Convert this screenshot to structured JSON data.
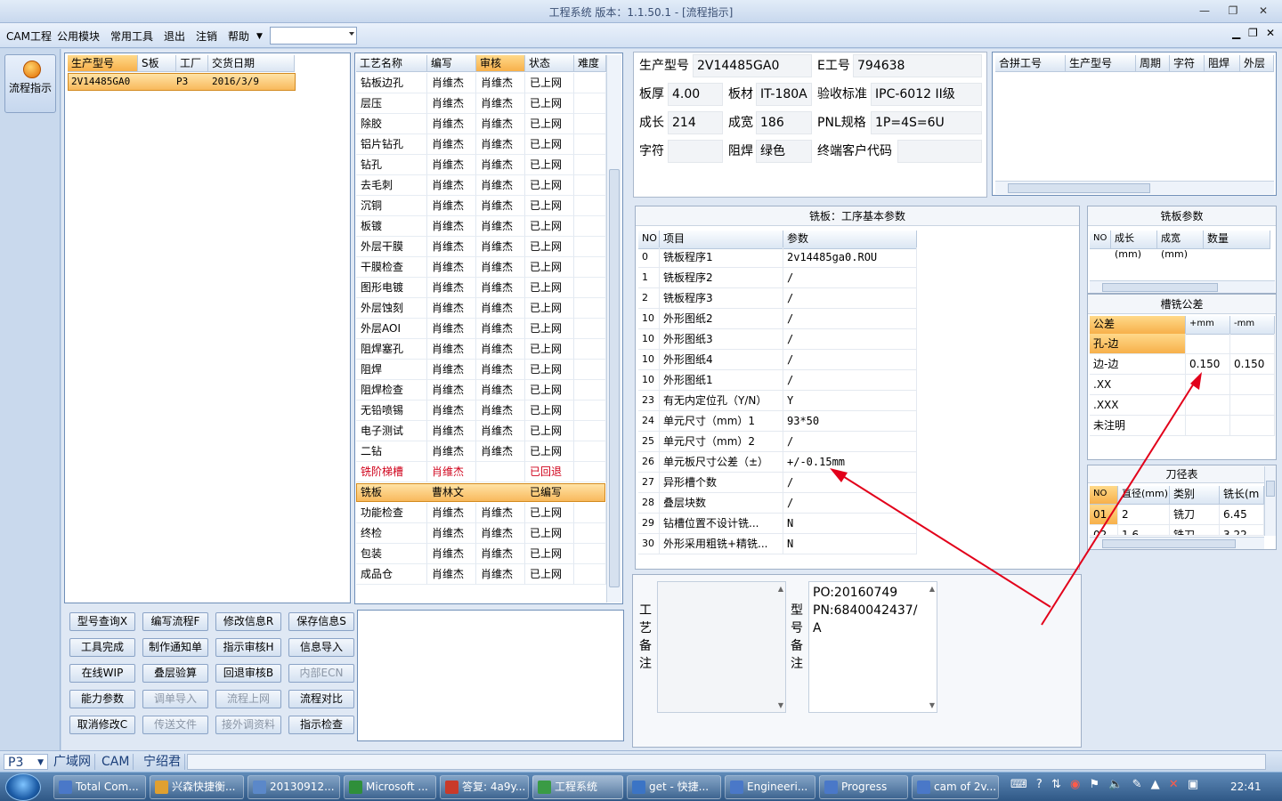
{
  "window": {
    "title": "工程系统   版本：1.1.50.1 - [流程指示]"
  },
  "menu": [
    "CAM工程",
    "公用模块",
    "常用工具",
    "退出",
    "注销",
    "帮助"
  ],
  "sidebar": {
    "label": "流程指示"
  },
  "orders": {
    "headers": [
      "生产型号",
      "S板",
      "工厂",
      "交货日期"
    ],
    "rows": [
      [
        "2V14485GA0",
        "",
        "P3",
        "2016/3/9"
      ]
    ]
  },
  "process": {
    "headers": [
      "工艺名称",
      "编写",
      "审核",
      "状态",
      "难度"
    ],
    "rows": [
      [
        "钻板边孔",
        "肖维杰",
        "肖维杰",
        "已上网"
      ],
      [
        "层压",
        "肖维杰",
        "肖维杰",
        "已上网"
      ],
      [
        "除胶",
        "肖维杰",
        "肖维杰",
        "已上网"
      ],
      [
        "铝片钻孔",
        "肖维杰",
        "肖维杰",
        "已上网"
      ],
      [
        "钻孔",
        "肖维杰",
        "肖维杰",
        "已上网"
      ],
      [
        "去毛刺",
        "肖维杰",
        "肖维杰",
        "已上网"
      ],
      [
        "沉铜",
        "肖维杰",
        "肖维杰",
        "已上网"
      ],
      [
        "板镀",
        "肖维杰",
        "肖维杰",
        "已上网"
      ],
      [
        "外层干膜",
        "肖维杰",
        "肖维杰",
        "已上网"
      ],
      [
        "干膜检查",
        "肖维杰",
        "肖维杰",
        "已上网"
      ],
      [
        "图形电镀",
        "肖维杰",
        "肖维杰",
        "已上网"
      ],
      [
        "外层蚀刻",
        "肖维杰",
        "肖维杰",
        "已上网"
      ],
      [
        "外层AOI",
        "肖维杰",
        "肖维杰",
        "已上网"
      ],
      [
        "阻焊塞孔",
        "肖维杰",
        "肖维杰",
        "已上网"
      ],
      [
        "阻焊",
        "肖维杰",
        "肖维杰",
        "已上网"
      ],
      [
        "阻焊检查",
        "肖维杰",
        "肖维杰",
        "已上网"
      ],
      [
        "无铅喷锡",
        "肖维杰",
        "肖维杰",
        "已上网"
      ],
      [
        "电子测试",
        "肖维杰",
        "肖维杰",
        "已上网"
      ],
      [
        "二钻",
        "肖维杰",
        "肖维杰",
        "已上网"
      ],
      [
        "铣阶梯槽",
        "肖维杰",
        "",
        "已回退"
      ],
      [
        "铣板",
        "曹林文",
        "",
        "已编写"
      ],
      [
        "功能检查",
        "肖维杰",
        "肖维杰",
        "已上网"
      ],
      [
        "终检",
        "肖维杰",
        "肖维杰",
        "已上网"
      ],
      [
        "包装",
        "肖维杰",
        "肖维杰",
        "已上网"
      ],
      [
        "成品仓",
        "肖维杰",
        "肖维杰",
        "已上网"
      ]
    ]
  },
  "buttons": [
    [
      "型号查询X",
      "编写流程F",
      "修改信息R",
      "保存信息S"
    ],
    [
      "工具完成",
      "制作通知单",
      "指示审核H",
      "信息导入"
    ],
    [
      "在线WIP",
      "叠层验算",
      "回退审核B",
      "内部ECN"
    ],
    [
      "能力参数",
      "调单导入",
      "流程上网",
      "流程对比"
    ],
    [
      "取消修改C",
      "传送文件",
      "接外调资料",
      "指示检查"
    ]
  ],
  "info": {
    "model_label": "生产型号",
    "model": "2V14485GA0",
    "eno_label": "E工号",
    "eno": "794638",
    "thickness_label": "板厚",
    "thickness": "4.00",
    "material_label": "板材",
    "material": "IT-180A",
    "standard_label": "验收标准",
    "standard": "IPC-6012 II级",
    "length_label": "成长",
    "length": "214",
    "width_label": "成宽",
    "width": "186",
    "pnl_label": "PNL规格",
    "pnl": "1P=4S=6U",
    "char_label": "字符",
    "char": "",
    "mask_label": "阻焊",
    "mask": "绿色",
    "customer_label": "终端客户代码",
    "customer": ""
  },
  "merge": {
    "headers": [
      "合拼工号",
      "生产型号",
      "周期",
      "字符",
      "阻焊",
      "外层"
    ]
  },
  "params": {
    "title": "铣板：工序基本参数",
    "headers": [
      "NO",
      "项目",
      "参数"
    ],
    "rows": [
      [
        "0",
        "铣板程序1",
        "2v14485ga0.ROU"
      ],
      [
        "1",
        "铣板程序2",
        "/"
      ],
      [
        "2",
        "铣板程序3",
        "/"
      ],
      [
        "10",
        "外形图纸2",
        "/"
      ],
      [
        "10",
        "外形图纸3",
        "/"
      ],
      [
        "10",
        "外形图纸4",
        "/"
      ],
      [
        "10",
        "外形图纸1",
        "/"
      ],
      [
        "23",
        "有无内定位孔（Y/N）",
        "Y"
      ],
      [
        "24",
        "单元尺寸（mm）1",
        "93*50"
      ],
      [
        "25",
        "单元尺寸（mm）2",
        "/"
      ],
      [
        "26",
        "单元板尺寸公差（±）",
        "+/-0.15mm"
      ],
      [
        "27",
        "异形槽个数",
        "/"
      ],
      [
        "28",
        "叠层块数",
        "/"
      ],
      [
        "29",
        "钻槽位置不设计铣...",
        "N"
      ],
      [
        "30",
        "外形采用粗铣+精铣...",
        "N"
      ]
    ]
  },
  "mill_params": {
    "title": "铣板参数",
    "headers": [
      "NO",
      "成长(mm)",
      "成宽(mm)",
      "数量"
    ]
  },
  "slot_tol": {
    "title": "槽铣公差",
    "headers": [
      "公差",
      "+mm",
      "-mm"
    ],
    "rows": [
      [
        "孔-边",
        "",
        ""
      ],
      [
        "边-边",
        "0.150",
        "0.150"
      ],
      [
        ".XX",
        "",
        ""
      ],
      [
        ".XXX",
        "",
        ""
      ],
      [
        "未注明",
        "",
        ""
      ]
    ]
  },
  "tools": {
    "title": "刀径表",
    "headers": [
      "NO",
      "直径(mm)",
      "类别",
      "铣长(m"
    ],
    "rows": [
      [
        "01",
        "2",
        "铣刀",
        "6.45"
      ],
      [
        "02",
        "1.6",
        "铣刀",
        "3.22"
      ]
    ]
  },
  "remarks": {
    "process_label": "工艺备注",
    "model_label": "型号备注",
    "model_text": [
      "PO:20160749",
      "PN:6840042437/",
      "A"
    ]
  },
  "status": {
    "factory": "P3",
    "tabs": [
      "广域网",
      "CAM",
      "宁绍君"
    ]
  },
  "taskbar": {
    "items": [
      "Total Com...",
      "兴森快捷衡...",
      "20130912...",
      "Microsoft ...",
      "答复: 4a9y...",
      "工程系统",
      "get - 快捷...",
      "Engineeri...",
      "Progress",
      "cam of 2v..."
    ],
    "clock": "22:41"
  }
}
